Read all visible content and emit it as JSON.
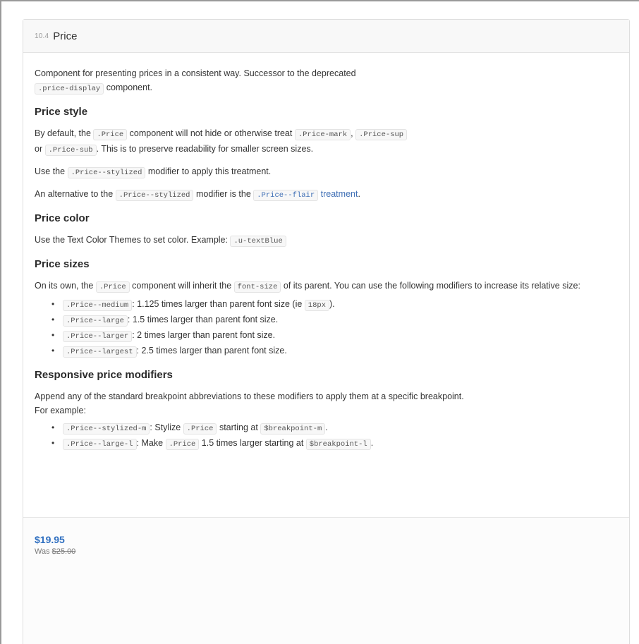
{
  "header": {
    "section_number": "10.4",
    "title": "Price"
  },
  "intro": {
    "text_a": "Component for presenting prices in a consistent way. Successor to the deprecated",
    "code_a": ".price-display",
    "text_b": " component."
  },
  "price_style": {
    "heading": "Price style",
    "p1_text_a": "By default, the ",
    "p1_code_a": ".Price",
    "p1_text_b": " component will not hide or otherwise treat ",
    "p1_code_b": ".Price-mark",
    "p1_text_c": ", ",
    "p1_code_c": ".Price-sup",
    "p1_text_d": " or ",
    "p1_code_d": ".Price-sub",
    "p1_text_e": ". This is to preserve readability for smaller screen sizes.",
    "p2_text_a": "Use the ",
    "p2_code_a": ".Price--stylized",
    "p2_text_b": " modifier to apply this treatment.",
    "p3_text_a": "An alternative to the ",
    "p3_code_a": ".Price--stylized",
    "p3_text_b": " modifier is the ",
    "p3_link_code": ".Price--flair",
    "p3_link_text": " treatment",
    "p3_text_c": "."
  },
  "price_color": {
    "heading": "Price color",
    "text_a": "Use the Text Color Themes to set color. Example: ",
    "code_a": ".u-textBlue"
  },
  "price_sizes": {
    "heading": "Price sizes",
    "text_a": "On its own, the ",
    "code_a": ".Price",
    "text_b": " component will inherit the ",
    "code_b": "font-size",
    "text_c": " of its parent. You can use the following modifiers to increase its relative size:",
    "items": [
      {
        "code": ".Price--medium",
        "text": ": 1.125 times larger than parent font size (ie ",
        "code2": "18px",
        "text2": ")."
      },
      {
        "code": ".Price--large",
        "text": ": 1.5 times larger than parent font size."
      },
      {
        "code": ".Price--larger",
        "text": ": 2 times larger than parent font size."
      },
      {
        "code": ".Price--largest",
        "text": ": 2.5 times larger than parent font size."
      }
    ]
  },
  "responsive": {
    "heading": "Responsive price modifiers",
    "text_a": "Append any of the standard breakpoint abbreviations to these modifiers to apply them at a specific breakpoint. For example:",
    "items": [
      {
        "code": ".Price--stylized-m",
        "text": ": Stylize ",
        "code2": ".Price",
        "text2": " starting at ",
        "code3": "$breakpoint-m",
        "text3": "."
      },
      {
        "code": ".Price--large-l",
        "text": ": Make ",
        "code2": ".Price",
        "text2": " 1.5 times larger starting at ",
        "code3": "$breakpoint-l",
        "text3": "."
      }
    ]
  },
  "example": {
    "price": "$19.95",
    "was_label": "Was ",
    "was_price": "$25.00"
  },
  "colors": {
    "link": "#3f6fb5",
    "price": "#2f6fc0"
  }
}
